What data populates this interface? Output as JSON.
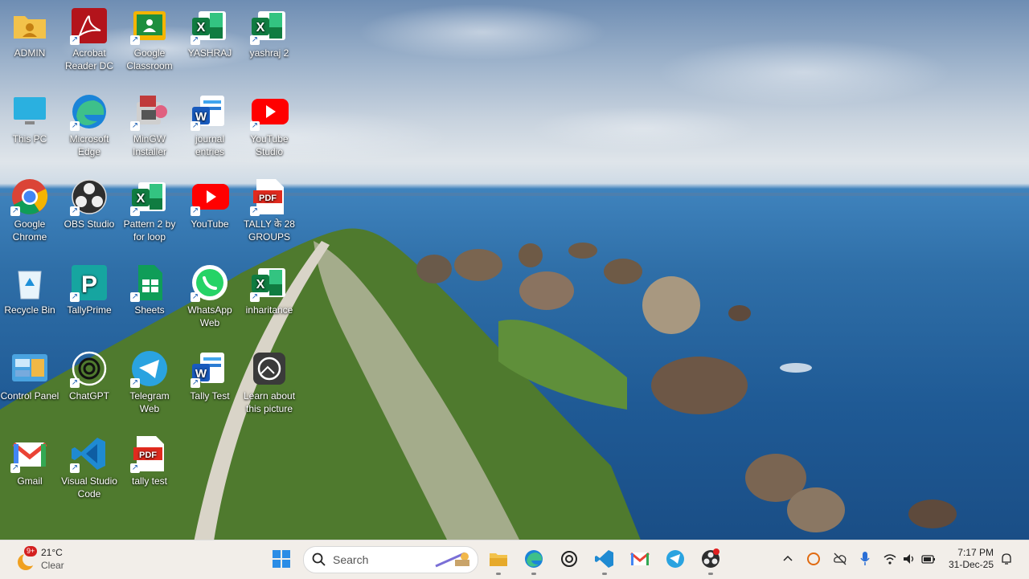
{
  "desktop": {
    "icons": [
      {
        "label": "ADMIN",
        "icon": "folder-user-icon"
      },
      {
        "label": "Acrobat Reader DC",
        "icon": "acrobat-icon"
      },
      {
        "label": "Google Classroom",
        "icon": "classroom-icon"
      },
      {
        "label": "YASHRAJ",
        "icon": "excel-icon"
      },
      {
        "label": "yashraj 2",
        "icon": "excel-icon"
      },
      {
        "label": "This PC",
        "icon": "monitor-icon"
      },
      {
        "label": "Microsoft Edge",
        "icon": "edge-icon"
      },
      {
        "label": "MinGW Installer",
        "icon": "mingw-icon"
      },
      {
        "label": "journal entries",
        "icon": "word-icon"
      },
      {
        "label": "YouTube Studio",
        "icon": "youtube-icon"
      },
      {
        "label": "Google Chrome",
        "icon": "chrome-icon"
      },
      {
        "label": "OBS Studio",
        "icon": "obs-icon"
      },
      {
        "label": "Pattern 2 by for loop",
        "icon": "excel-icon"
      },
      {
        "label": "YouTube",
        "icon": "youtube-icon"
      },
      {
        "label": "TALLY के 28 GROUPS",
        "icon": "pdf-icon"
      },
      {
        "label": "Recycle Bin",
        "icon": "recycle-bin-icon"
      },
      {
        "label": "TallyPrime",
        "icon": "tallyprime-icon"
      },
      {
        "label": "Sheets",
        "icon": "sheets-icon"
      },
      {
        "label": "WhatsApp Web",
        "icon": "whatsapp-icon"
      },
      {
        "label": "inharitance",
        "icon": "excel-icon"
      },
      {
        "label": "Control Panel",
        "icon": "control-panel-icon"
      },
      {
        "label": "ChatGPT",
        "icon": "chatgpt-icon"
      },
      {
        "label": "Telegram Web",
        "icon": "telegram-icon"
      },
      {
        "label": "Tally Test",
        "icon": "word-icon"
      },
      {
        "label": "Learn about this picture",
        "icon": "learn-icon"
      },
      {
        "label": "Gmail",
        "icon": "gmail-icon"
      },
      {
        "label": "Visual Studio Code",
        "icon": "vscode-icon"
      },
      {
        "label": "tally test",
        "icon": "pdf-icon"
      }
    ]
  },
  "taskbar": {
    "weather": {
      "temp": "21°C",
      "condition": "Clear",
      "badge": "9+"
    },
    "search_placeholder": "Search",
    "pinned": [
      "windows-start-icon",
      "file-explorer-icon",
      "edge-icon",
      "chatgpt-icon",
      "vscode-icon",
      "gmail-icon",
      "telegram-icon",
      "obs-icon"
    ],
    "tray": {
      "time": "7:17 PM",
      "date": "31-Dec-25"
    }
  }
}
